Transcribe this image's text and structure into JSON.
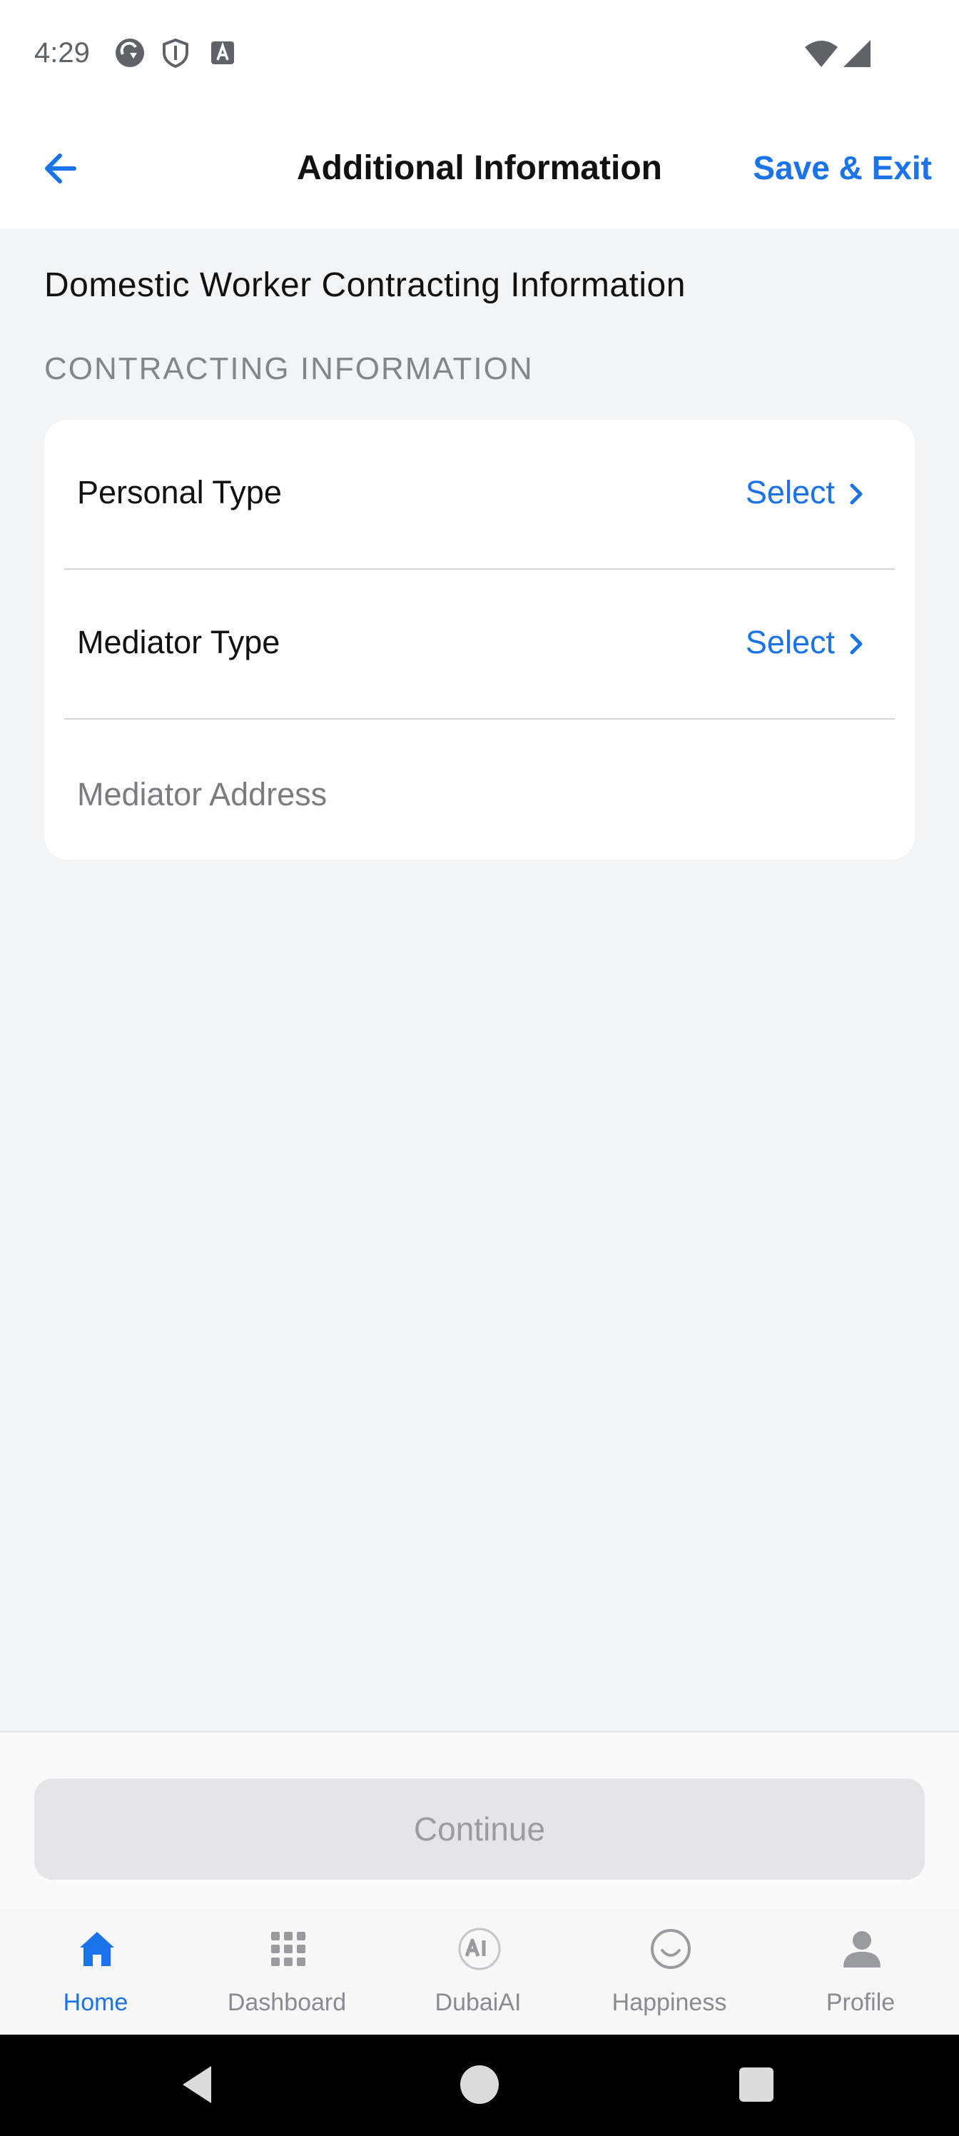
{
  "status_bar": {
    "time": "4:29"
  },
  "header": {
    "title": "Additional Information",
    "save_exit_label": "Save & Exit"
  },
  "section": {
    "title": "Domestic Worker Contracting Information",
    "subtitle": "CONTRACTING INFORMATION"
  },
  "form": {
    "personal_type": {
      "label": "Personal Type",
      "value": "Select"
    },
    "mediator_type": {
      "label": "Mediator Type",
      "value": "Select"
    },
    "mediator_address": {
      "placeholder": "Mediator Address",
      "value": ""
    }
  },
  "actions": {
    "continue_label": "Continue"
  },
  "tabs": [
    {
      "label": "Home",
      "icon": "home-icon",
      "active": true
    },
    {
      "label": "Dashboard",
      "icon": "grid-icon",
      "active": false
    },
    {
      "label": "DubaiAI",
      "icon": "ai-icon",
      "active": false
    },
    {
      "label": "Happiness",
      "icon": "smiley-icon",
      "active": false
    },
    {
      "label": "Profile",
      "icon": "person-icon",
      "active": false
    }
  ],
  "colors": {
    "accent": "#1a73e8",
    "background": "#f3f4f6",
    "disabled_button": "#e4e4e9"
  }
}
